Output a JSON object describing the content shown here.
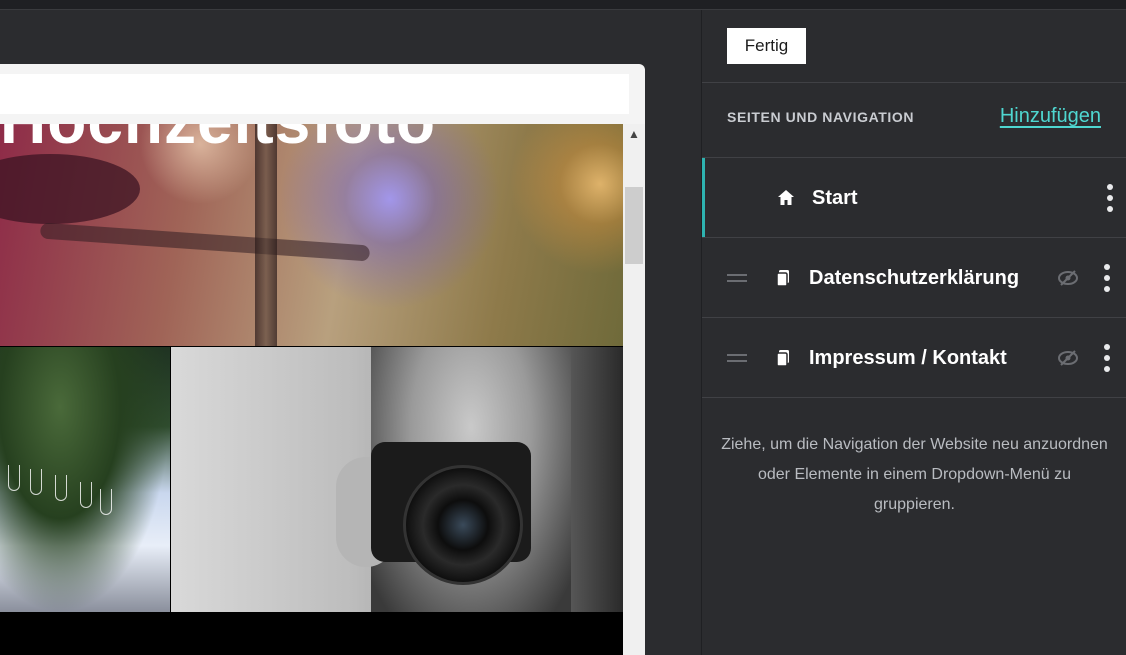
{
  "preview": {
    "hero_title": "Hochzeitsfoto"
  },
  "sidebar": {
    "done_label": "Fertig",
    "section_title": "SEITEN UND NAVIGATION",
    "add_label": "Hinzufügen",
    "items": [
      {
        "label": "Start",
        "icon": "home-icon",
        "active": true,
        "hidden": false
      },
      {
        "label": "Datenschutzerklärung",
        "icon": "page-icon",
        "active": false,
        "hidden": true
      },
      {
        "label": "Impressum / Kontakt",
        "icon": "page-icon",
        "active": false,
        "hidden": true
      }
    ],
    "help_text": "Ziehe, um die Navigation der Website neu anzuordnen oder Elemente in einem Dropdown-Menü zu gruppieren."
  },
  "colors": {
    "accent": "#4fd6d0",
    "active_border": "#2eb3b0",
    "sidebar_bg": "#2b2c2f"
  }
}
